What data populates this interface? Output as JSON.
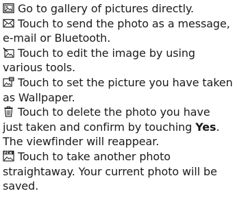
{
  "items": [
    {
      "icon": "gallery-icon",
      "text": "Go to gallery of pictures directly."
    },
    {
      "icon": "envelope-icon",
      "text": "Touch to send the photo as a message, e-mail or Bluetooth."
    },
    {
      "icon": "edit-image-icon",
      "text": "Touch to edit the image by using various tools."
    },
    {
      "icon": "set-wallpaper-icon",
      "text": "Touch to set the picture you have taken as Wallpaper."
    },
    {
      "icon": "trash-icon",
      "text_before": "Touch to delete the photo you have just taken and confirm by touching",
      "bold": "Yes",
      "text_after": ". The viewfinder will reappear."
    },
    {
      "icon": "new-photo-icon",
      "text": "Touch to take another photo straightaway. Your current photo will be saved."
    }
  ]
}
